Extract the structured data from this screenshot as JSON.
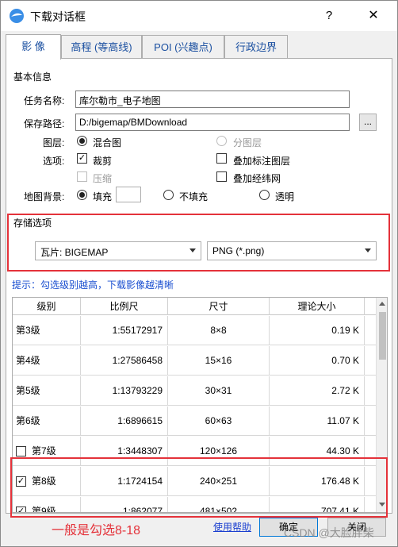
{
  "window": {
    "title": "下载对话框",
    "help": "?",
    "close": "✕"
  },
  "tabs": [
    {
      "label": "影 像"
    },
    {
      "label": "高程 (等高线)"
    },
    {
      "label": "POI (兴趣点)"
    },
    {
      "label": "行政边界"
    }
  ],
  "basic": {
    "group_title": "基本信息",
    "task_label": "任务名称:",
    "task_value": "库尔勒市_电子地图",
    "path_label": "保存路径:",
    "path_value": "D:/bigemap/BMDownload",
    "browse": "...",
    "layer_label": "图层:",
    "layer_mixed": "混合图",
    "layer_split": "分图层",
    "options_label": "选项:",
    "opt_clip": "裁剪",
    "opt_overlay_label": "叠加标注图层",
    "opt_compress": "压缩",
    "opt_overlay_grid": "叠加经纬网",
    "bg_label": "地图背景:",
    "bg_fill": "填充",
    "bg_nofill": "不填充",
    "bg_transparent": "透明"
  },
  "storage": {
    "group_title": "存储选项",
    "tile_format": "瓦片: BIGEMAP",
    "image_format": "PNG (*.png)"
  },
  "hint": "提示：勾选级别越高，下载影像越清晰",
  "table": {
    "headers": [
      "级别",
      "比例尺",
      "尺寸",
      "理论大小"
    ],
    "rows": [
      {
        "level": "第3级",
        "scale": "1:55172917",
        "size": "8×8",
        "est": "0.19 K",
        "checkbox": false,
        "checked": false
      },
      {
        "level": "第4级",
        "scale": "1:27586458",
        "size": "15×16",
        "est": "0.70 K",
        "checkbox": false,
        "checked": false
      },
      {
        "level": "第5级",
        "scale": "1:13793229",
        "size": "30×31",
        "est": "2.72 K",
        "checkbox": false,
        "checked": false
      },
      {
        "level": "第6级",
        "scale": "1:6896615",
        "size": "60×63",
        "est": "11.07 K",
        "checkbox": false,
        "checked": false
      },
      {
        "level": "第7级",
        "scale": "1:3448307",
        "size": "120×126",
        "est": "44.30 K",
        "checkbox": true,
        "checked": false
      },
      {
        "level": "第8级",
        "scale": "1:1724154",
        "size": "240×251",
        "est": "176.48 K",
        "checkbox": true,
        "checked": true
      },
      {
        "level": "第9级",
        "scale": "1:862077",
        "size": "481×502",
        "est": "707.41 K",
        "checkbox": true,
        "checked": true
      }
    ]
  },
  "footer": {
    "note": "一般是勾选8-18",
    "help_link": "使用帮助",
    "ok": "确定",
    "cancel": "关闭",
    "watermark": "CSDN @大脸胖柴"
  },
  "colors": {
    "highlight": "#e4323a",
    "link": "#1a3fd0",
    "tab_text": "#1a4fa0"
  }
}
